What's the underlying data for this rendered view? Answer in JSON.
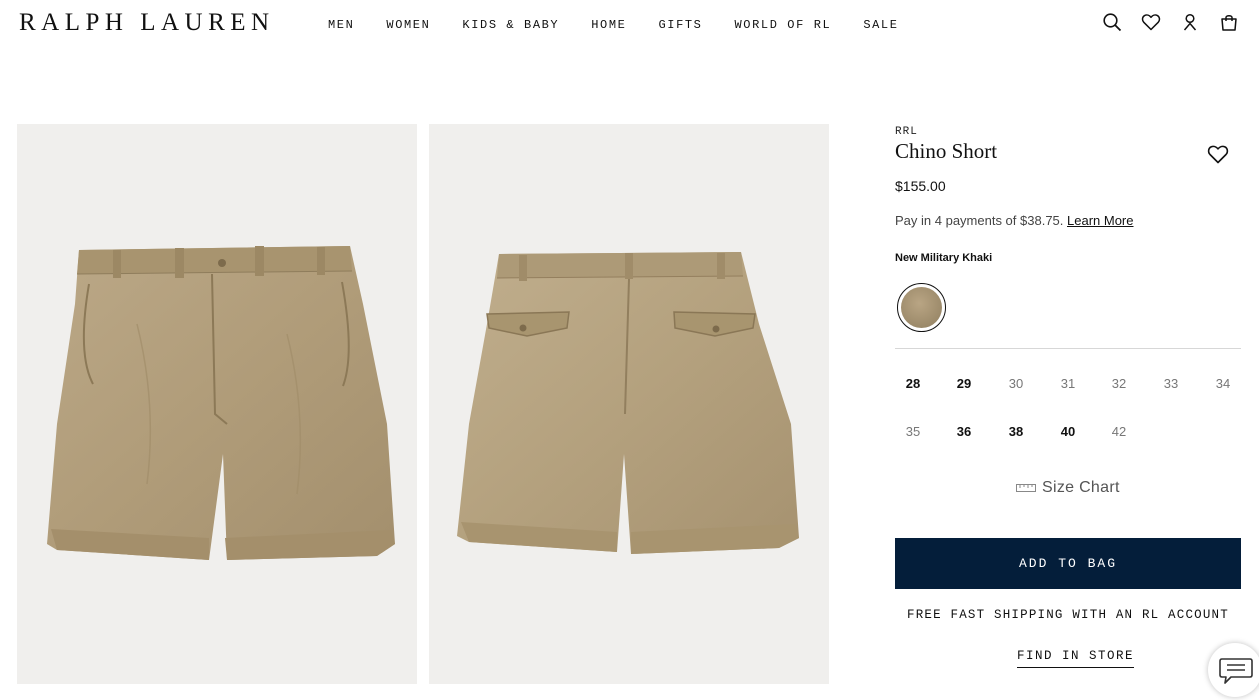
{
  "header": {
    "logo": "RALPH LAUREN",
    "nav": [
      "MEN",
      "WOMEN",
      "KIDS & BABY",
      "HOME",
      "GIFTS",
      "WORLD OF RL",
      "SALE"
    ],
    "icons": [
      "search-icon",
      "heart-icon",
      "account-icon",
      "bag-icon"
    ]
  },
  "gallery": {
    "images": [
      "chino-short-front",
      "chino-short-back"
    ]
  },
  "product": {
    "brand": "RRL",
    "title": "Chino Short",
    "price": "$155.00",
    "installment_text": "Pay in 4 payments of $38.75.",
    "learn_more": "Learn More",
    "color_name": "New Military Khaki",
    "swatch_color": "#a9977a",
    "sizes": [
      {
        "label": "28",
        "available": true
      },
      {
        "label": "29",
        "available": true
      },
      {
        "label": "30",
        "available": false
      },
      {
        "label": "31",
        "available": false
      },
      {
        "label": "32",
        "available": false
      },
      {
        "label": "33",
        "available": false
      },
      {
        "label": "34",
        "available": false
      },
      {
        "label": "35",
        "available": false
      },
      {
        "label": "36",
        "available": true
      },
      {
        "label": "38",
        "available": true
      },
      {
        "label": "40",
        "available": true
      },
      {
        "label": "42",
        "available": false
      }
    ],
    "size_chart": "Size Chart",
    "add_to_bag": "ADD TO BAG",
    "shipping_note": "FREE FAST SHIPPING WITH AN RL ACCOUNT",
    "find_in_store": "FIND IN STORE"
  },
  "colors": {
    "navy": "#041e3a",
    "image_bg": "#f0efed",
    "khaki": "#b3a07e"
  }
}
